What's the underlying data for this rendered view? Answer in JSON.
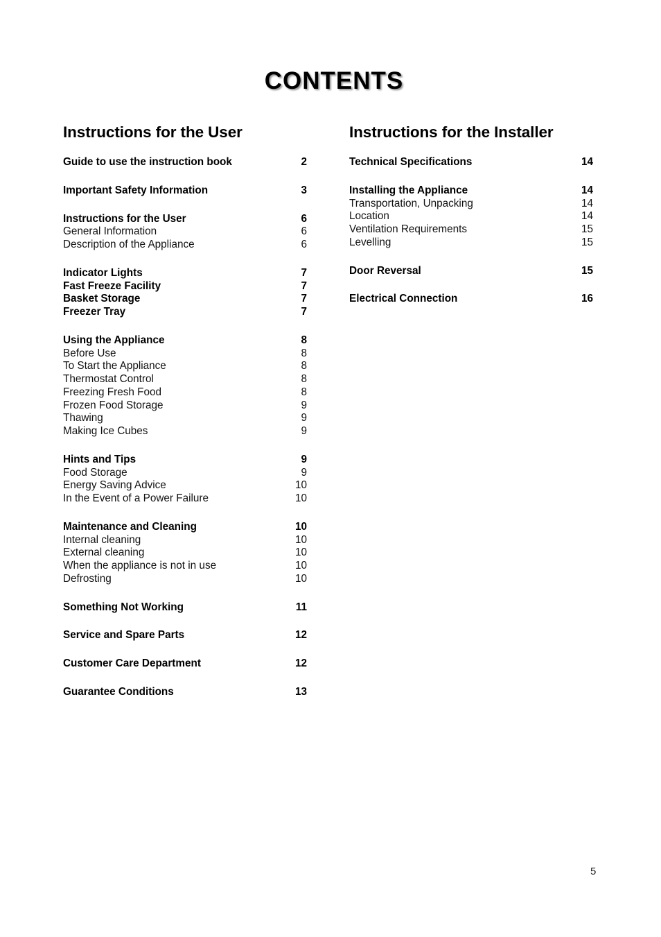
{
  "page_title": "CONTENTS",
  "columns": [
    {
      "heading": "Instructions for the User",
      "groups": [
        {
          "items": [
            {
              "label": "Guide to use the instruction book",
              "page": "2",
              "bold": true
            }
          ]
        },
        {
          "items": [
            {
              "label": "Important Safety Information",
              "page": "3",
              "bold": true
            }
          ]
        },
        {
          "items": [
            {
              "label": "Instructions for the User",
              "page": "6",
              "bold": true
            },
            {
              "label": "General Information",
              "page": "6",
              "bold": false
            },
            {
              "label": "Description of the Appliance",
              "page": "6",
              "bold": false
            }
          ]
        },
        {
          "items": [
            {
              "label": "Indicator Lights",
              "page": "7",
              "bold": true
            },
            {
              "label": "Fast Freeze Facility",
              "page": "7",
              "bold": true
            },
            {
              "label": "Basket Storage",
              "page": "7",
              "bold": true
            },
            {
              "label": "Freezer Tray",
              "page": "7",
              "bold": true
            }
          ]
        },
        {
          "items": [
            {
              "label": "Using the Appliance",
              "page": "8",
              "bold": true
            },
            {
              "label": "Before Use",
              "page": "8",
              "bold": false
            },
            {
              "label": "To Start the Appliance",
              "page": "8",
              "bold": false
            },
            {
              "label": "Thermostat Control",
              "page": "8",
              "bold": false
            },
            {
              "label": "Freezing Fresh Food",
              "page": "8",
              "bold": false
            },
            {
              "label": "Frozen Food Storage",
              "page": "9",
              "bold": false
            },
            {
              "label": "Thawing",
              "page": "9",
              "bold": false
            },
            {
              "label": "Making Ice Cubes",
              "page": "9",
              "bold": false
            }
          ]
        },
        {
          "items": [
            {
              "label": "Hints and Tips",
              "page": "9",
              "bold": true
            },
            {
              "label": "Food Storage",
              "page": "9",
              "bold": false
            },
            {
              "label": "Energy Saving Advice",
              "page": "10",
              "bold": false
            },
            {
              "label": "In the Event of a Power Failure",
              "page": "10",
              "bold": false
            }
          ]
        },
        {
          "items": [
            {
              "label": "Maintenance and Cleaning",
              "page": "10",
              "bold": true
            },
            {
              "label": "Internal cleaning",
              "page": "10",
              "bold": false
            },
            {
              "label": "External cleaning",
              "page": "10",
              "bold": false
            },
            {
              "label": "When the appliance is not in use",
              "page": "10",
              "bold": false
            },
            {
              "label": "Defrosting",
              "page": "10",
              "bold": false
            }
          ]
        },
        {
          "items": [
            {
              "label": "Something Not Working",
              "page": "11",
              "bold": true
            }
          ]
        },
        {
          "items": [
            {
              "label": "Service and Spare Parts",
              "page": "12",
              "bold": true
            }
          ]
        },
        {
          "items": [
            {
              "label": "Customer Care Department",
              "page": "12",
              "bold": true
            }
          ]
        },
        {
          "items": [
            {
              "label": "Guarantee Conditions",
              "page": "13",
              "bold": true
            }
          ]
        }
      ]
    },
    {
      "heading": "Instructions for the Installer",
      "groups": [
        {
          "items": [
            {
              "label": "Technical Specifications",
              "page": "14",
              "bold": true
            }
          ]
        },
        {
          "items": [
            {
              "label": "Installing the Appliance",
              "page": "14",
              "bold": true
            },
            {
              "label": "Transportation, Unpacking",
              "page": "14",
              "bold": false
            },
            {
              "label": "Location",
              "page": "14",
              "bold": false
            },
            {
              "label": "Ventilation Requirements",
              "page": "15",
              "bold": false
            },
            {
              "label": "Levelling",
              "page": "15",
              "bold": false
            }
          ]
        },
        {
          "items": [
            {
              "label": "Door Reversal",
              "page": "15",
              "bold": true
            }
          ]
        },
        {
          "items": [
            {
              "label": "Electrical Connection",
              "page": "16",
              "bold": true
            }
          ]
        }
      ]
    }
  ],
  "footer": {
    "page_number": "5"
  }
}
